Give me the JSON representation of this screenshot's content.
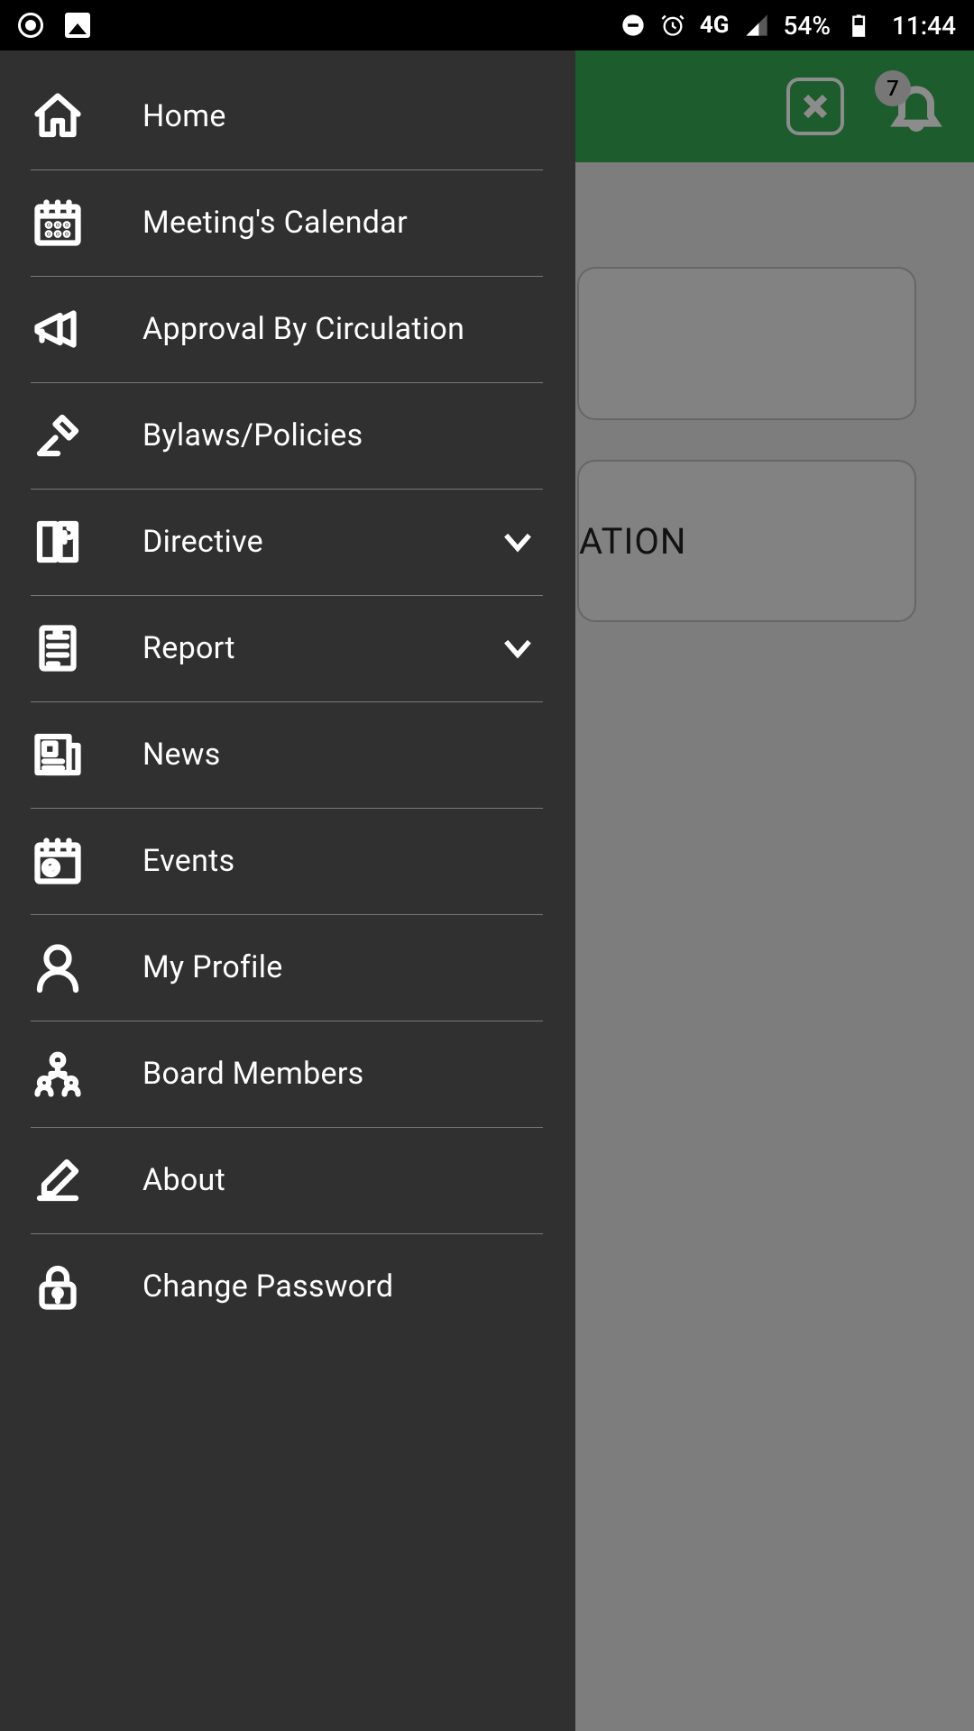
{
  "status": {
    "network": "4G",
    "battery": "54%",
    "time": "11:44"
  },
  "header": {
    "notification_count": "7"
  },
  "background": {
    "card2_fragment": "ATION"
  },
  "menu": {
    "home": "Home",
    "calendar": "Meeting's Calendar",
    "approval": "Approval By Circulation",
    "bylaws": "Bylaws/Policies",
    "directive": "Directive",
    "report": "Report",
    "news": "News",
    "events": "Events",
    "profile": "My Profile",
    "board": "Board Members",
    "about": "About",
    "password": "Change Password"
  }
}
